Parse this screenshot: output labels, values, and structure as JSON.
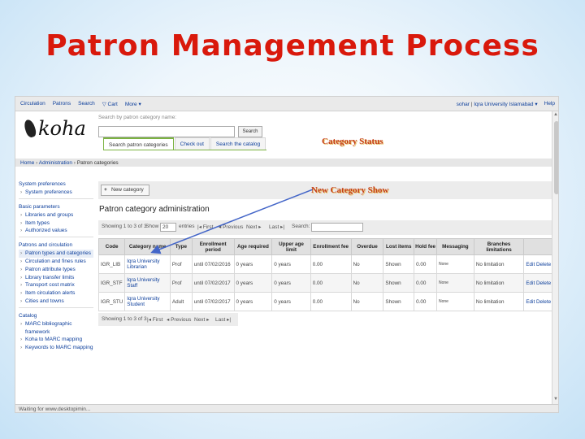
{
  "slide": {
    "title": "Patron Management Process",
    "annotations": {
      "category_status": "Category  Status",
      "new_category_show": "New Category Show"
    },
    "colors": {
      "title": "#d9190c",
      "annotation": "#c43d16",
      "link": "#0c3e9b",
      "arrow": "#4466c8"
    }
  },
  "topnav": {
    "items": [
      "Circulation",
      "Patrons",
      "Search",
      "Cart",
      "More"
    ],
    "cart_icon": "cart-icon",
    "more_caret": "▾",
    "user": "sohar",
    "library": "Iqra University Islamabad",
    "library_caret": "▾",
    "help": "Help",
    "separator": "|"
  },
  "logo": {
    "text": "koha",
    "icon": "koha-leaf-icon"
  },
  "search": {
    "label": "Search by patron category name:",
    "value": "",
    "button": "Search",
    "tabs": [
      "Search patron categories",
      "Check out",
      "Search the catalog"
    ]
  },
  "breadcrumb": {
    "parts": [
      "Home",
      "Administration",
      "Patron categories"
    ],
    "sep": " › "
  },
  "sidebar": {
    "sections": [
      {
        "head": "System preferences",
        "items": [
          "System preferences"
        ]
      },
      {
        "head": "Basic parameters",
        "items": [
          "Libraries and groups",
          "Item types",
          "Authorized values"
        ]
      },
      {
        "head": "Patrons and circulation",
        "items": [
          "Patron types and categories",
          "Circulation and fines rules",
          "Patron attribute types",
          "Library transfer limits",
          "Transport cost matrix",
          "Item circulation alerts",
          "Cities and towns"
        ]
      },
      {
        "head": "Catalog",
        "items": [
          "MARC bibliographic framework",
          "Koha to MARC mapping",
          "Keywords to MARC mapping"
        ]
      }
    ]
  },
  "toolbar": {
    "new_category": "New category",
    "plus": "+"
  },
  "page": {
    "heading": "Patron category administration"
  },
  "pager": {
    "showing": "Showing 1 to 3 of 3",
    "show": "Show",
    "per_page": "20",
    "entries": "entries",
    "first": "First",
    "previous": "Previous",
    "next": "Next",
    "last": "Last",
    "search": "Search:",
    "arrows": {
      "first": "|◂",
      "previous": "◂",
      "next": "▸",
      "last": "▸|"
    }
  },
  "table": {
    "headers": [
      "Code",
      "Category name",
      "Type",
      "Enrollment period",
      "Age required",
      "Upper age limit",
      "Enrollment fee",
      "Overdue",
      "Lost items",
      "Hold fee",
      "Messaging",
      "Branches limitations",
      ""
    ],
    "rows": [
      {
        "code": "IGR_LIB",
        "name": "Iqra University Librarian",
        "type": "Prof",
        "period": "until 07/02/2016",
        "age": "0 years",
        "upper": "0 years",
        "fee": "0.00",
        "overdue": "No",
        "lost": "Shown",
        "hold": "0.00",
        "messaging": "None",
        "branches": "No limitation",
        "edit": "Edit",
        "delete": "Delete"
      },
      {
        "code": "IGR_STF",
        "name": "Iqra University Staff",
        "type": "Prof",
        "period": "until 07/02/2017",
        "age": "0 years",
        "upper": "0 years",
        "fee": "0.00",
        "overdue": "No",
        "lost": "Shown",
        "hold": "0.00",
        "messaging": "None",
        "branches": "No limitation",
        "edit": "Edit",
        "delete": "Delete"
      },
      {
        "code": "IGR_STU",
        "name": "Iqra University Student",
        "type": "Adult",
        "period": "until 07/02/2017",
        "age": "0 years",
        "upper": "0 years",
        "fee": "0.00",
        "overdue": "No",
        "lost": "Shown",
        "hold": "0.00",
        "messaging": "None",
        "branches": "No limitation",
        "edit": "Edit",
        "delete": "Delete"
      }
    ]
  },
  "statusbar": {
    "text": "Waiting for www.desktopimin..."
  }
}
